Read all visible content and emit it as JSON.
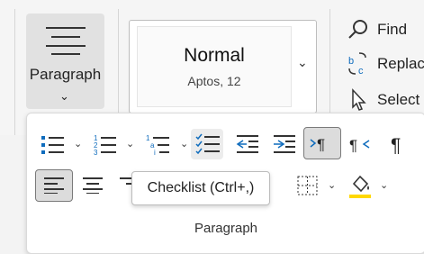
{
  "paragraph_group": {
    "label": "Paragraph",
    "chevron": "⌄"
  },
  "styles": {
    "current_name": "Normal",
    "current_font": "Aptos, 12",
    "chevron": "⌄"
  },
  "editing": {
    "find": "Find",
    "replace": "Replac",
    "select": "Select"
  },
  "panel": {
    "group_label": "Paragraph",
    "tooltip": "Checklist (Ctrl+,)"
  },
  "colors": {
    "accent": "#0f6cbd",
    "highlight_yellow": "#ffd800"
  }
}
